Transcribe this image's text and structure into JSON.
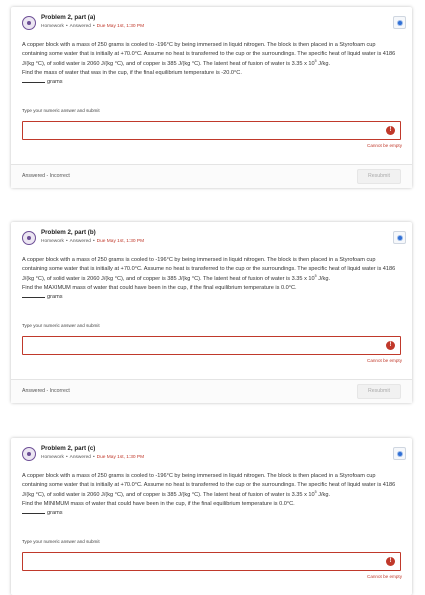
{
  "problems": [
    {
      "title": "Problem 2, part (a)",
      "type": "Homework",
      "status": "Answered",
      "due": "Due May 1st, 1:30 PM",
      "text_main": "A copper block with a mass of 250 grams is cooled to -196°C by being immersed in liquid nitrogen. The block is then placed in a Styrofoam cup containing some water that is initially at +70.0°C. Assume no heat is transferred to the cup or the surroundings. The specific heat of liquid water is 4186 J/(kg °C), of solid water is 2060 J/(kg °C), and of copper is 385 J/(kg °C). The latent heat of fusion of water is 3.35 x 10",
      "exp": "5",
      "unit_after": " J/kg.",
      "question": "Find the mass of water that was in the cup, if the final equilibrium temperature is -20.0°C.",
      "answer_unit": "grams",
      "input_label": "Type your numeric answer and submit",
      "input_value": "",
      "error": "Cannot be empty",
      "footer_status": "Answered - Incorrect",
      "resubmit": "Resubmit"
    },
    {
      "title": "Problem 2, part (b)",
      "type": "Homework",
      "status": "Answered",
      "due": "Due May 1st, 1:30 PM",
      "text_main": "A copper block with a mass of 250 grams is cooled to -196°C by being immersed in liquid nitrogen. The block is then placed in a Styrofoam cup containing some water that is initially at +70.0°C. Assume no heat is transferred to the cup or the surroundings. The specific heat of liquid water is 4186 J/(kg °C), of solid water is 2060 J/(kg °C), and of copper is 385 J/(kg °C). The latent heat of fusion of water is 3.35 x 10",
      "exp": "5",
      "unit_after": " J/kg.",
      "question": "Find the MAXIMUM mass of water that could have been in the cup, if the final equilibrium temperature is 0.0°C.",
      "answer_unit": "grams",
      "input_label": "Type your numeric answer and submit",
      "input_value": "",
      "error": "Cannot be empty",
      "footer_status": "Answered - Incorrect",
      "resubmit": "Resubmit"
    },
    {
      "title": "Problem 2, part (c)",
      "type": "Homework",
      "status": "Answered",
      "due": "Due May 1st, 1:30 PM",
      "text_main": "A copper block with a mass of 250 grams is cooled to -196°C by being immersed in liquid nitrogen. The block is then placed in a Styrofoam cup containing some water that is initially at +70.0°C. Assume no heat is transferred to the cup or the surroundings. The specific heat of liquid water is 4186 J/(kg °C), of solid water is 2060 J/(kg °C), and of copper is 385 J/(kg °C). The latent heat of fusion of water is 3.35 x 10",
      "exp": "5",
      "unit_after": " J/kg.",
      "question": "Find the MINIMUM mass of water that could have been in the cup, if the final equilibrium temperature is 0.0°C.",
      "answer_unit": "grams",
      "input_label": "Type your numeric answer and submit",
      "input_value": "",
      "error": "Cannot be empty"
    }
  ],
  "separator": "•",
  "error_icon_glyph": "!",
  "colors": {
    "error": "#c0392b",
    "accent": "#2f6fd6",
    "avatar": "#6d4f96"
  }
}
